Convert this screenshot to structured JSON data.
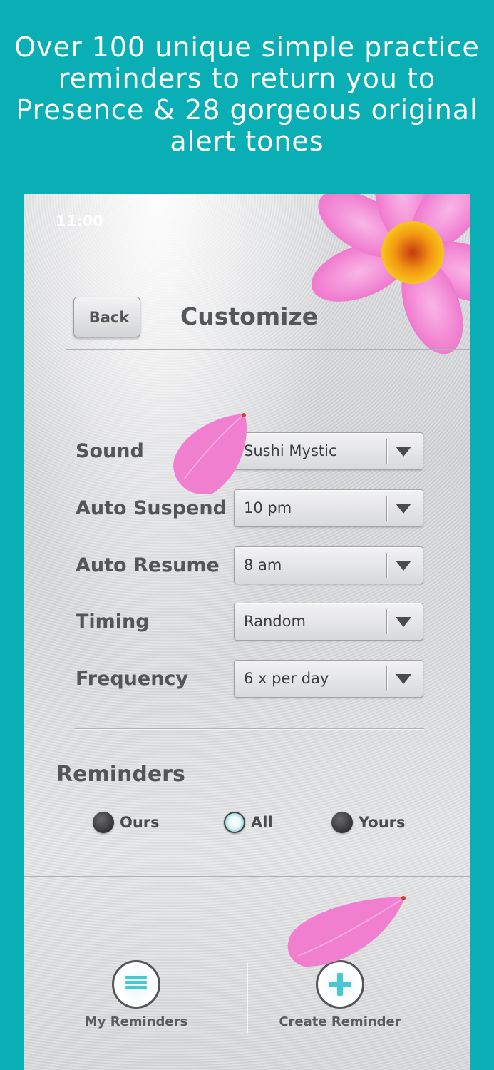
{
  "headline": "Over 100 unique simple practice reminders to return you to Presence & 28 gorgeous original alert tones",
  "status_bar": {
    "time": "11:00"
  },
  "nav": {
    "back_label": "Back",
    "title": "Customize"
  },
  "settings": [
    {
      "label": "Sound",
      "value": "Sushi Mystic"
    },
    {
      "label": "Auto Suspend",
      "value": "10 pm"
    },
    {
      "label": "Auto Resume",
      "value": "8 am"
    },
    {
      "label": "Timing",
      "value": "Random"
    },
    {
      "label": "Frequency",
      "value": "6 x per day"
    }
  ],
  "reminders": {
    "title": "Reminders",
    "options": [
      {
        "label": "Ours",
        "selected": false
      },
      {
        "label": "All",
        "selected": true
      },
      {
        "label": "Yours",
        "selected": false
      }
    ]
  },
  "tabs": [
    {
      "label": "My Reminders",
      "icon": "list-icon"
    },
    {
      "label": "Create Reminder",
      "icon": "plus-icon"
    }
  ],
  "colors": {
    "background": "#0aafb5",
    "flower": "#f07fd0",
    "accent": "#47c7d1"
  }
}
